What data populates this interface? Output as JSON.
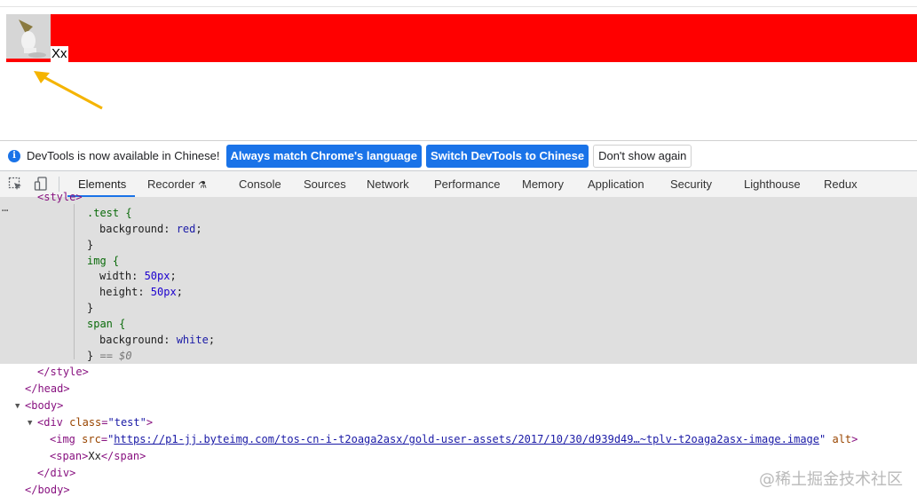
{
  "page": {
    "span_text": "Xx"
  },
  "infobar": {
    "message": "DevTools is now available in Chinese!",
    "btn_match": "Always match Chrome's language",
    "btn_switch": "Switch DevTools to Chinese",
    "btn_dont_show": "Don't show again"
  },
  "tabs": [
    "Elements",
    "Recorder",
    "Console",
    "Sources",
    "Network",
    "Performance",
    "Memory",
    "Application",
    "Security",
    "Lighthouse",
    "Redux"
  ],
  "colors": {
    "accent": "#1a73e8",
    "test_bg": "#ff0000",
    "arrow": "#f5b400"
  },
  "code": {
    "style_open_partial": "<style>",
    "css_test_sel": ".test {",
    "css_bg_prop": "background: ",
    "css_bg_red": "red",
    "css_close": "}",
    "css_img_sel": "img {",
    "css_width_prop": "width: ",
    "css_width_val": "50px",
    "css_height_prop": "height: ",
    "css_height_val": "50px",
    "css_span_sel": "span {",
    "css_bg_white": "white",
    "selected_marker": "== $0",
    "style_close": "</style>",
    "head_close": "</head>",
    "body_open": "<body>",
    "div_open_tag": "<div",
    "div_class_attr": "class",
    "div_class_val": "\"test\"",
    "img_tag": "<img",
    "img_src_attr": "src",
    "img_src_val": "https://p1-jj.byteimg.com/tos-cn-i-t2oaga2asx/gold-user-assets/2017/10/30/d939d49…~tplv-t2oaga2asx-image.image",
    "img_alt_attr": "alt",
    "span_line_open": "<span>",
    "span_line_text": "Xx",
    "span_line_close": "</span>",
    "div_close": "</div>",
    "body_close": "</body>"
  },
  "watermark": "@稀土掘金技术社区"
}
